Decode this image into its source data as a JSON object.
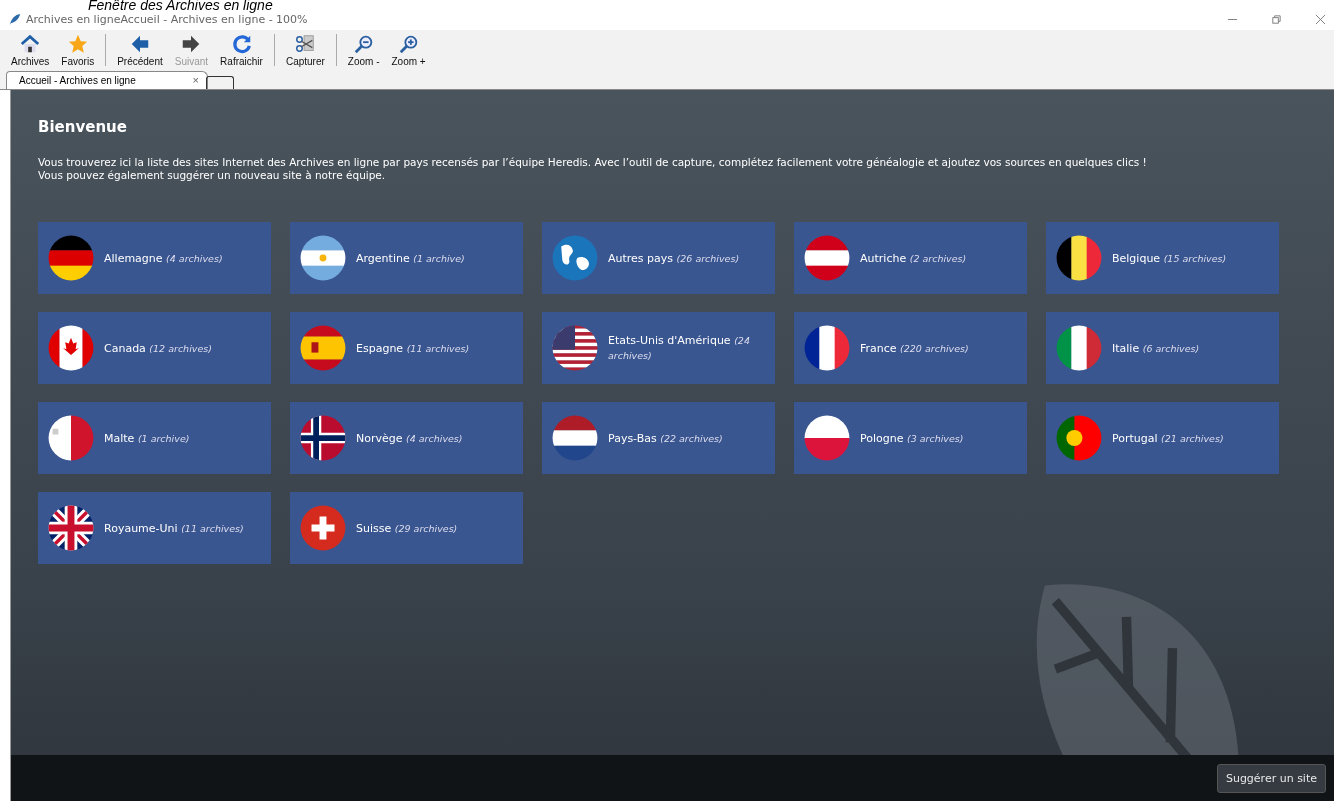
{
  "caption": "Fenêtre des Archives en ligne",
  "window": {
    "title": "Archives en ligneAccueil - Archives en ligne - 100%"
  },
  "toolbar": {
    "groups": [
      [
        {
          "kind": "home",
          "label": "Archives",
          "disabled": false
        },
        {
          "kind": "star",
          "label": "Favoris",
          "disabled": false
        }
      ],
      [
        {
          "kind": "back",
          "label": "Précédent",
          "disabled": false
        },
        {
          "kind": "forward",
          "label": "Suivant",
          "disabled": true
        },
        {
          "kind": "refresh",
          "label": "Rafraichir",
          "disabled": false
        }
      ],
      [
        {
          "kind": "capture",
          "label": "Capturer",
          "disabled": false
        }
      ],
      [
        {
          "kind": "zoomout",
          "label": "Zoom -",
          "disabled": false
        },
        {
          "kind": "zoomin",
          "label": "Zoom +",
          "disabled": false
        }
      ]
    ]
  },
  "tabs": [
    {
      "label": "Accueil - Archives en ligne",
      "close": "×",
      "selected": true
    }
  ],
  "heading": "Bienvenue",
  "intro": [
    "Vous trouverez ici la liste des sites Internet des Archives en ligne par pays recensés par l’équipe Heredis. Avec l’outil de capture, complétez facilement votre généalogie et ajoutez vos sources en quelques clics !",
    "Vous pouvez également suggérer un nouveau site à notre équipe."
  ],
  "countries": [
    {
      "kind": "de",
      "name": "Allemagne",
      "count": "(4 archives)"
    },
    {
      "kind": "ar",
      "name": "Argentine",
      "count": "(1 archive)"
    },
    {
      "kind": "world",
      "name": "Autres pays",
      "count": "(26 archives)"
    },
    {
      "kind": "at",
      "name": "Autriche",
      "count": "(2 archives)"
    },
    {
      "kind": "be",
      "name": "Belgique",
      "count": "(15 archives)"
    },
    {
      "kind": "ca",
      "name": "Canada",
      "count": "(12 archives)"
    },
    {
      "kind": "es",
      "name": "Espagne",
      "count": "(11 archives)"
    },
    {
      "kind": "us",
      "name": "Etats-Unis d'Amérique",
      "count": "(24 archives)"
    },
    {
      "kind": "fr",
      "name": "France",
      "count": "(220 archives)"
    },
    {
      "kind": "it",
      "name": "Italie",
      "count": "(6 archives)"
    },
    {
      "kind": "mt",
      "name": "Malte",
      "count": "(1 archive)"
    },
    {
      "kind": "no",
      "name": "Norvège",
      "count": "(4 archives)"
    },
    {
      "kind": "nl",
      "name": "Pays-Bas",
      "count": "(22 archives)"
    },
    {
      "kind": "pl",
      "name": "Pologne",
      "count": "(3 archives)"
    },
    {
      "kind": "pt",
      "name": "Portugal",
      "count": "(21 archives)"
    },
    {
      "kind": "gb",
      "name": "Royaume-Uni",
      "count": "(11 archives)"
    },
    {
      "kind": "ch",
      "name": "Suisse",
      "count": "(29 archives)"
    }
  ],
  "suggest_button": "Suggérer un site"
}
